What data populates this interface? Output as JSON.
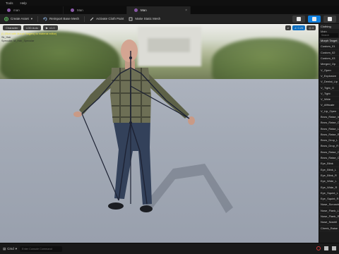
{
  "menu": [
    "Tools",
    "Help"
  ],
  "tabs": [
    {
      "label": "man",
      "active": false
    },
    {
      "label": "Man",
      "active": false
    },
    {
      "label": "Man",
      "active": true
    }
  ],
  "toolbar": {
    "create_asset": "Create Asset",
    "reimport": "Reimport Base Mesh",
    "cloth": "Activate Cloth Paint",
    "static_mesh": "Make Static Mesh"
  },
  "viewport": {
    "perspective": "Perspective",
    "lit": "Lit",
    "character": "Character",
    "lod": "LOD Auto",
    "speed": "x1.0",
    "right_value_1": "0.25",
    "right_value_2": "4",
    "warn_line": "(!) (Skel with Morph Targets) to material editor)",
    "sub_line_1": "Sk_Hair",
    "sub_line_2": "Specular: M_Hair_Specular"
  },
  "panel": {
    "tab": "Clothing",
    "head": "Main",
    "search": "Search",
    "header_item": "Morph Target",
    "items": [
      "Custom_01",
      "Custom_02",
      "Custom_03",
      "Merged_Op",
      "V_Open",
      "V_Explosive",
      "V_Dental_Lip",
      "V_Tight_O",
      "V_Tight",
      "V_Wide",
      "V_Affricate",
      "V_Lip_Open",
      "Brow_Raise_In",
      "Brow_Raise_Out",
      "Brow_Raise_L",
      "Brow_Raise_R",
      "Brow_Drop_L",
      "Brow_Drop_R",
      "Brow_Raise_C",
      "Brow_Raise_C2",
      "Eye_Blink",
      "Eye_Blink_L",
      "Eye_Blink_R",
      "Eye_Wide_L",
      "Eye_Wide_R",
      "Eye_Squint_L",
      "Eye_Squint_R",
      "Nose_Scrunch",
      "Nose_Flank_L",
      "Nose_Flank_R",
      "Nose_Nostril",
      "Cheek_Raise"
    ]
  },
  "bottom": {
    "drawer": "Cmd",
    "cmd_placeholder": "Enter Console Command"
  },
  "colors": {
    "accent": "#0d7fe0",
    "warning": "#f2e24a",
    "record": "#d23a3a"
  }
}
